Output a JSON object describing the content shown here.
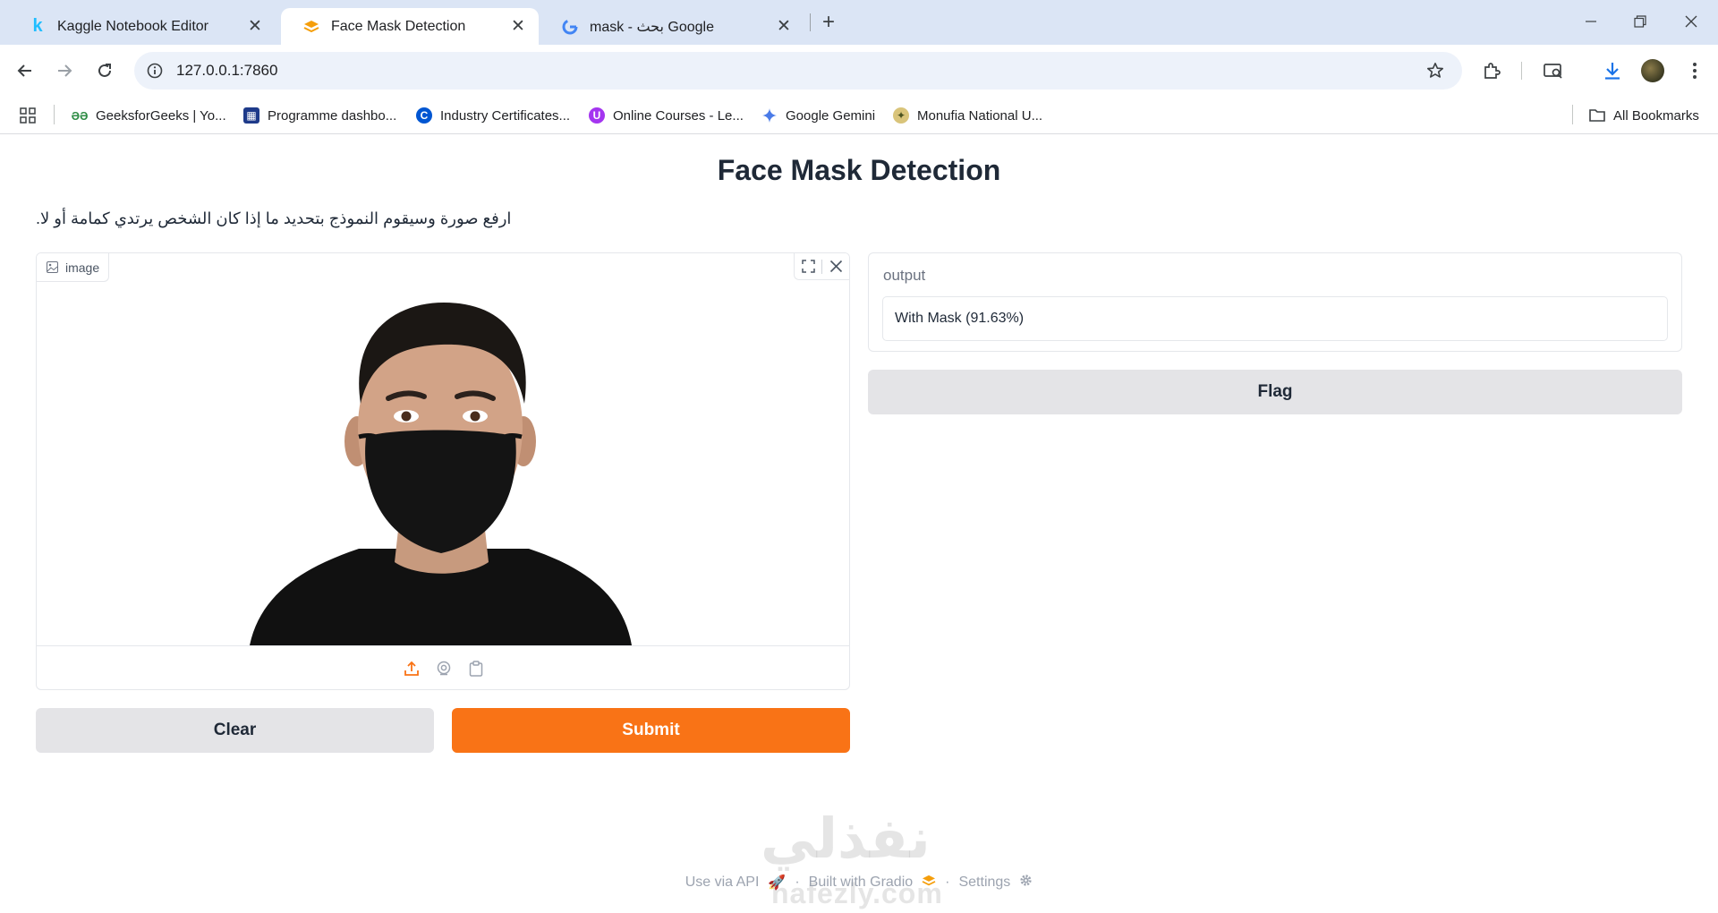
{
  "browser": {
    "tabs": [
      {
        "title": "Kaggle Notebook Editor",
        "favicon": "kaggle-k-icon"
      },
      {
        "title": "Face Mask Detection",
        "favicon": "gradio-logo-icon"
      },
      {
        "title": "mask - بحث Google",
        "favicon": "google-g-icon"
      }
    ],
    "url": "127.0.0.1:7860",
    "bookmarks": [
      {
        "label": "GeeksforGeeks | Yo...",
        "icon": "gfg-icon"
      },
      {
        "label": "Programme dashbo...",
        "icon": "programme-icon"
      },
      {
        "label": "Industry Certificates...",
        "icon": "coursera-icon"
      },
      {
        "label": "Online Courses - Le...",
        "icon": "udemy-icon"
      },
      {
        "label": "Google Gemini",
        "icon": "gemini-icon"
      },
      {
        "label": "Monufia National U...",
        "icon": "university-icon"
      }
    ],
    "all_bookmarks": "All Bookmarks"
  },
  "app": {
    "title": "Face Mask Detection",
    "description": "ارفع صورة وسيقوم النموذج بتحديد ما إذا كان الشخص يرتدي كمامة أو لا.",
    "image_label": "image",
    "clear_label": "Clear",
    "submit_label": "Submit",
    "output_label": "output",
    "output_value": "With Mask (91.63%)",
    "flag_label": "Flag"
  },
  "footer": {
    "api": "Use via API",
    "built": "Built with Gradio",
    "settings": "Settings"
  },
  "watermark": {
    "arabic": "نفذلي",
    "latin": "nafezly.com"
  },
  "colors": {
    "accent": "#f97316",
    "secondary_button": "#e4e4e7",
    "tabstrip": "#dbe5f5"
  }
}
